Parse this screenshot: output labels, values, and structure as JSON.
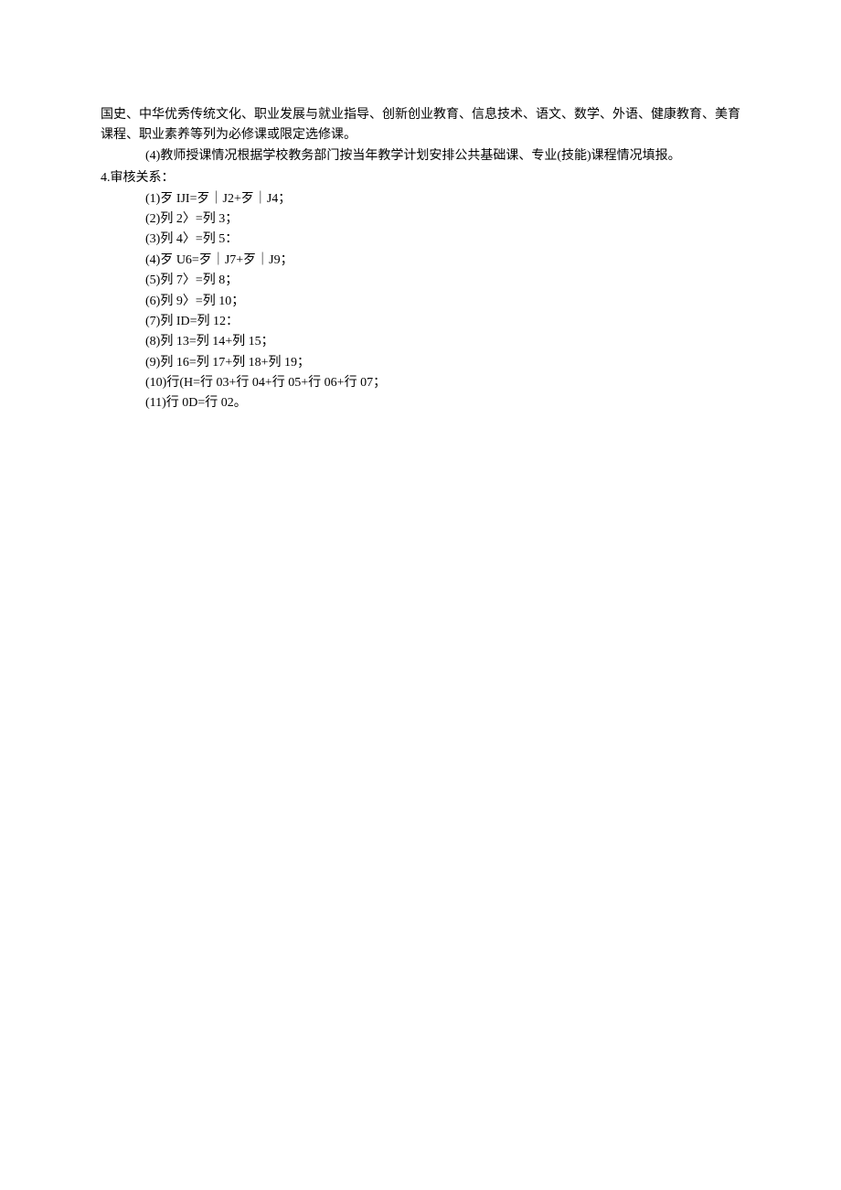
{
  "para1": "国史、中华优秀传统文化、职业发展与就业指导、创新创业教育、信息技术、语文、数学、外语、健康教育、美育课程、职业素养等列为必修课或限定选修课。",
  "para2": "(4)教师授课情况根据学校教务部门按当年教学计划安排公共基础课、专业(技能)课程情况填报。",
  "heading": "4.审核关系：",
  "items": [
    "(1)歹 IJI=歹｜J2+歹｜J4；",
    "(2)列 2〉=列 3；",
    "(3)列 4〉=列 5：",
    "(4)歹 U6=歹｜J7+歹｜J9；",
    "(5)列 7〉=列 8；",
    "(6)列 9〉=列 10；",
    "(7)列 ID=列 12：",
    "(8)列 13=列 14+列 15；",
    "(9)列 16=列 17+列 18+列 19；",
    "(10)行(H=行 03+行 04+行 05+行 06+行 07；",
    "(11)行 0D=行 02。"
  ]
}
